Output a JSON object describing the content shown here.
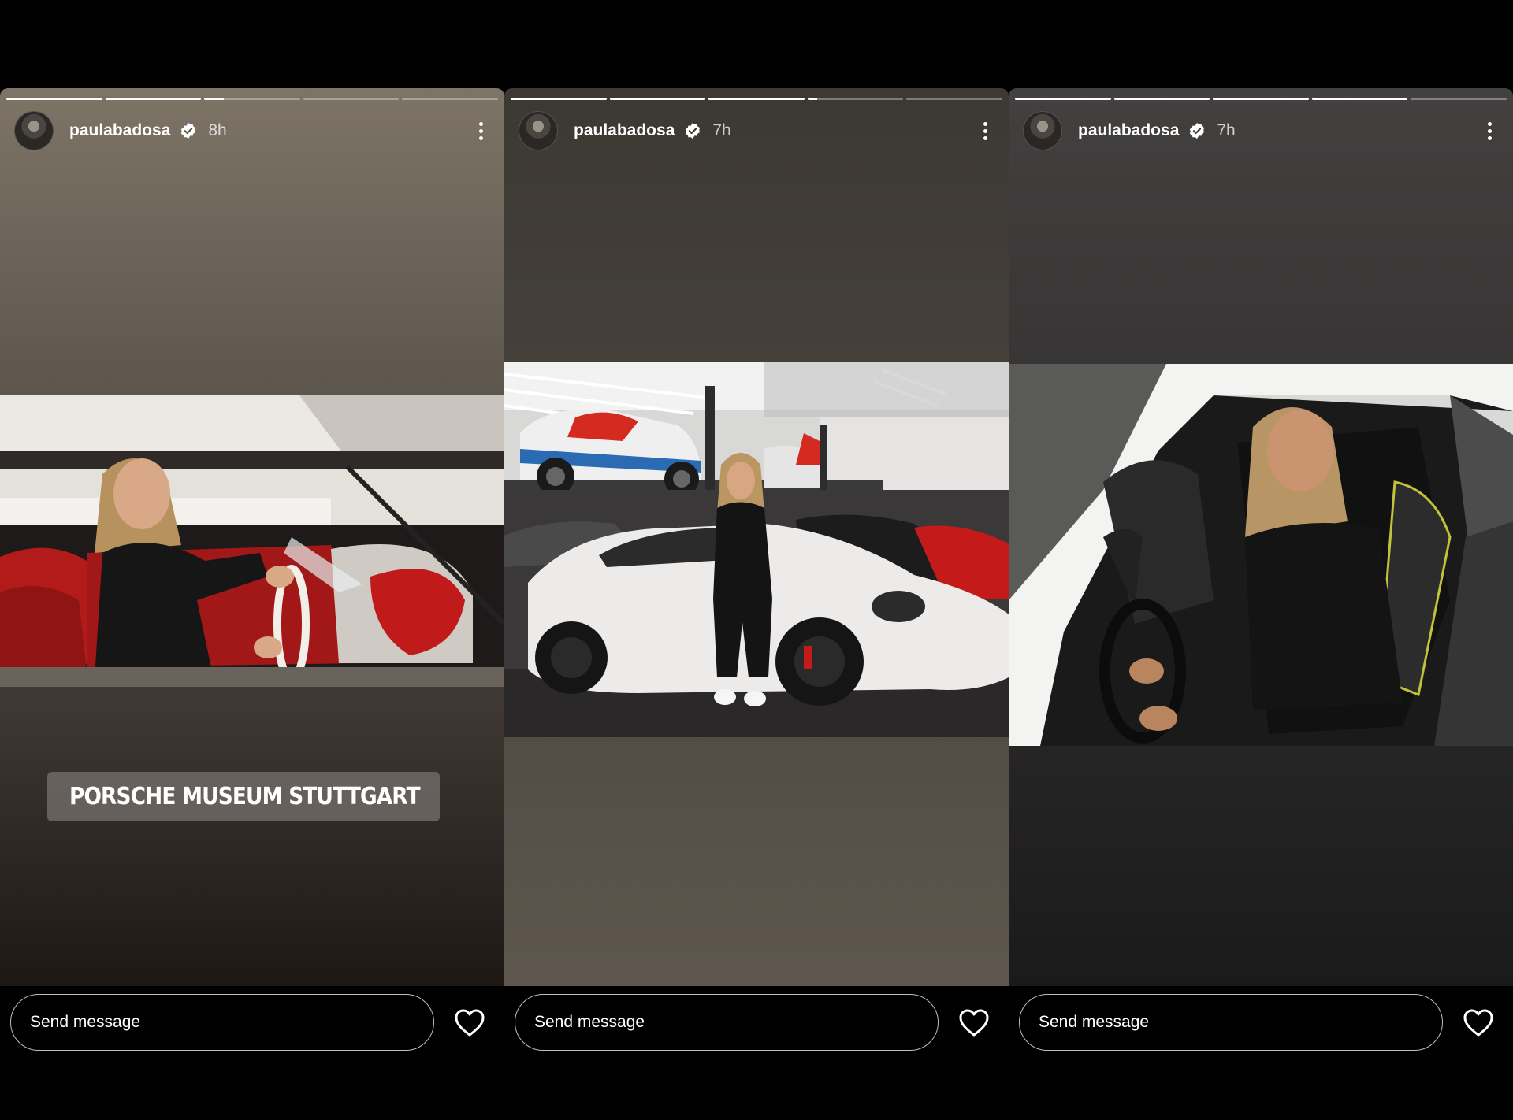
{
  "stories": [
    {
      "username": "paulabadosa",
      "time": "8h",
      "progress": [
        1,
        1,
        0.2,
        0,
        0
      ],
      "location_sticker": "PORSCHE MUSEUM STUTTGART",
      "message_placeholder": "Send message"
    },
    {
      "username": "paulabadosa",
      "time": "7h",
      "progress": [
        1,
        1,
        1,
        0.1,
        0
      ],
      "message_placeholder": "Send message"
    },
    {
      "username": "paulabadosa",
      "time": "7h",
      "progress": [
        1,
        1,
        1,
        1,
        0
      ],
      "message_placeholder": "Send message"
    }
  ],
  "icons": {
    "verified": "verified-badge-icon",
    "more": "more-options-icon",
    "heart": "heart-icon",
    "pin": "location-pin-icon"
  }
}
